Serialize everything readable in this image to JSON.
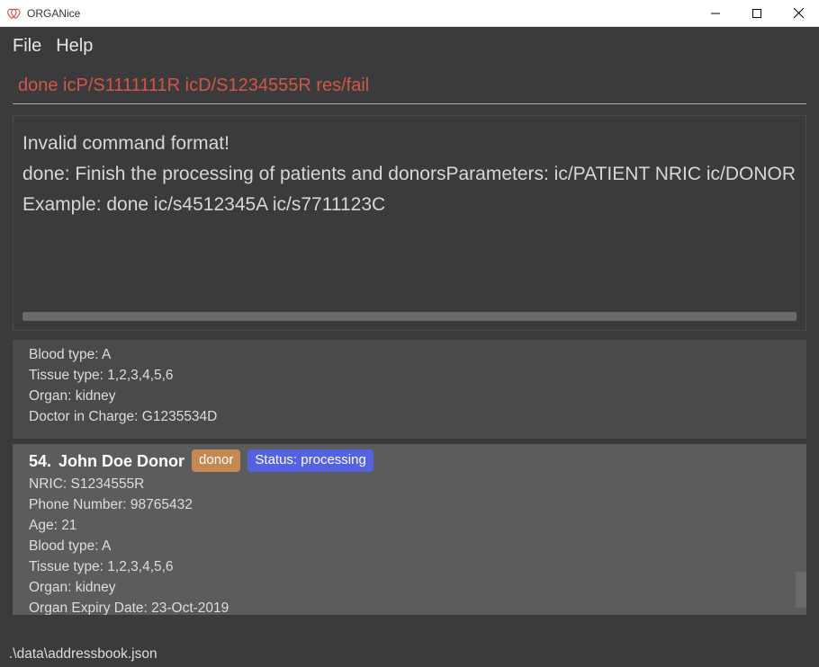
{
  "window": {
    "title": "ORGANice"
  },
  "menu": {
    "file": "File",
    "help": "Help"
  },
  "command_input": "done icP/S1111111R icD/S1234555R res/fail",
  "result": {
    "line1": "Invalid command format!",
    "line2": "done: Finish the processing of patients and donorsParameters: ic/PATIENT NRIC ic/DONOR NRI",
    "line3": "Example: done ic/s4512345A ic/s7711123C"
  },
  "cards": {
    "top_partial": {
      "blood": "Blood type: A",
      "tissue": "Tissue type: 1,2,3,4,5,6",
      "organ": "Organ: kidney",
      "doctor": "Doctor in Charge: G1235534D"
    },
    "donor": {
      "index": "54.",
      "name": "John Doe Donor",
      "tag_donor": "donor",
      "tag_status": "Status: processing",
      "nric": "NRIC: S1234555R",
      "phone": "Phone Number: 98765432",
      "age": "Age: 21",
      "blood": "Blood type: A",
      "tissue": "Tissue type: 1,2,3,4,5,6",
      "organ": "Organ: kidney",
      "expiry": "Organ Expiry Date: 23-Oct-2019"
    }
  },
  "statusbar": ".\\data\\addressbook.json"
}
